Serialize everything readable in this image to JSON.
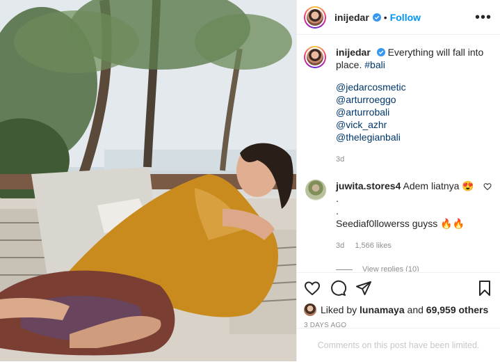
{
  "post": {
    "username": "inijedar",
    "follow_label": "Follow",
    "separator": "•",
    "more_label": "•••",
    "caption": {
      "text": "Everything will fall into place.",
      "hashtag": "#bali",
      "mentions": [
        "@jedarcosmetic",
        "@arturroeggo",
        "@arturrobali",
        "@vick_azhr",
        "@thelegianbali"
      ],
      "age": "3d"
    },
    "comment": {
      "username": "juwita.stores4",
      "line1": "Adem liatnya 😍",
      "line2": ".",
      "line3": ".",
      "line4": "Seediaf0llowerss guyss 🔥🔥",
      "age": "3d",
      "likes": "1,566 likes",
      "view_replies": "View replies (10)"
    },
    "likes": {
      "prefix": "Liked by",
      "user": "lunamaya",
      "conjunction": "and",
      "others": "69,959 others"
    },
    "date": "3 DAYS AGO",
    "comments_limited": "Comments on this post have been limited."
  },
  "colors": {
    "link": "#0095f6",
    "mention": "#00376b",
    "muted": "#8e8e8e",
    "verified": "#3897f0",
    "dress": "#c98b1e"
  },
  "icons": [
    "verified-badge-icon",
    "more-options-icon",
    "heart-icon",
    "comment-icon",
    "share-icon",
    "bookmark-icon"
  ]
}
